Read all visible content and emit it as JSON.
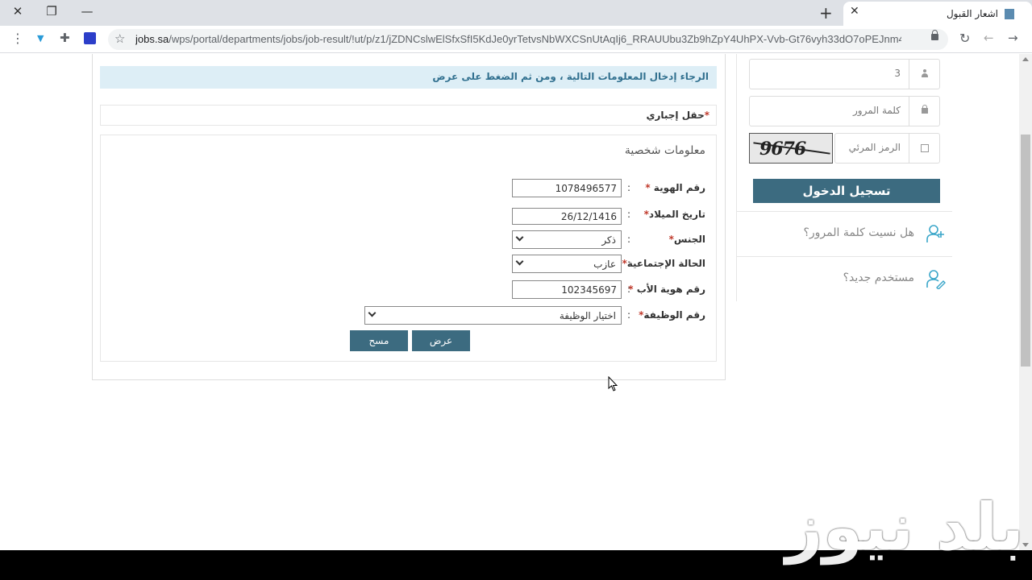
{
  "browser": {
    "tab_title": "اشعار القبول",
    "new_tab": "+",
    "tab_close": "✕",
    "url_host": "jobs.sa",
    "url_path": "/wps/portal/departments/jobs/job-result/!ut/p/z1/jZDNCslwElSfxSfI5KdJe0yrTetvsNbWXCSnUtAqIj6_RRAUUbu3Zb9hZpY4UhPX-Vvb-Gt76vyh33dO7oPEJnm44HS...",
    "window_controls": [
      "✕",
      "❐",
      "—"
    ]
  },
  "main": {
    "info_message": "الرجاء إدخال المعلومات التالية ، ومن ثم الضغط على عرض",
    "required_note": "حقل إجباري",
    "required_star": "*",
    "form_title": "معلومات شخصية",
    "colon": ":",
    "fields": [
      {
        "label": "رقم الهوية",
        "star": "*",
        "value": "1078496577"
      },
      {
        "label": "تاريخ الميلاد",
        "star": "*",
        "value": "26/12/1416"
      },
      {
        "label": "الجنس",
        "star": "*",
        "value": "ذكر"
      },
      {
        "label": "الحالة الإجتماعية",
        "star": "*",
        "value": "عازب"
      },
      {
        "label": "رقم هوية الأب",
        "star": "*",
        "value": "102345697"
      },
      {
        "label": "رقم الوظيفة",
        "star": "*",
        "value": "اختيار الوظيفة"
      }
    ],
    "buttons": {
      "show": "عرض",
      "clear": "مسح"
    }
  },
  "sidebar": {
    "username_value": "3",
    "password_placeholder": "كلمة المرور",
    "captcha_placeholder": "الرمز المرئي",
    "captcha_text": "9676",
    "login_button": "تسجيل الدخول",
    "forgot_password": "هل نسيت كلمة المرور؟",
    "new_user": "مستخدم جديد؟"
  },
  "watermark": "بلد نيوز",
  "colors": {
    "accent": "#3c6b80",
    "info_bg": "#ddeef6",
    "info_text": "#31708f"
  }
}
